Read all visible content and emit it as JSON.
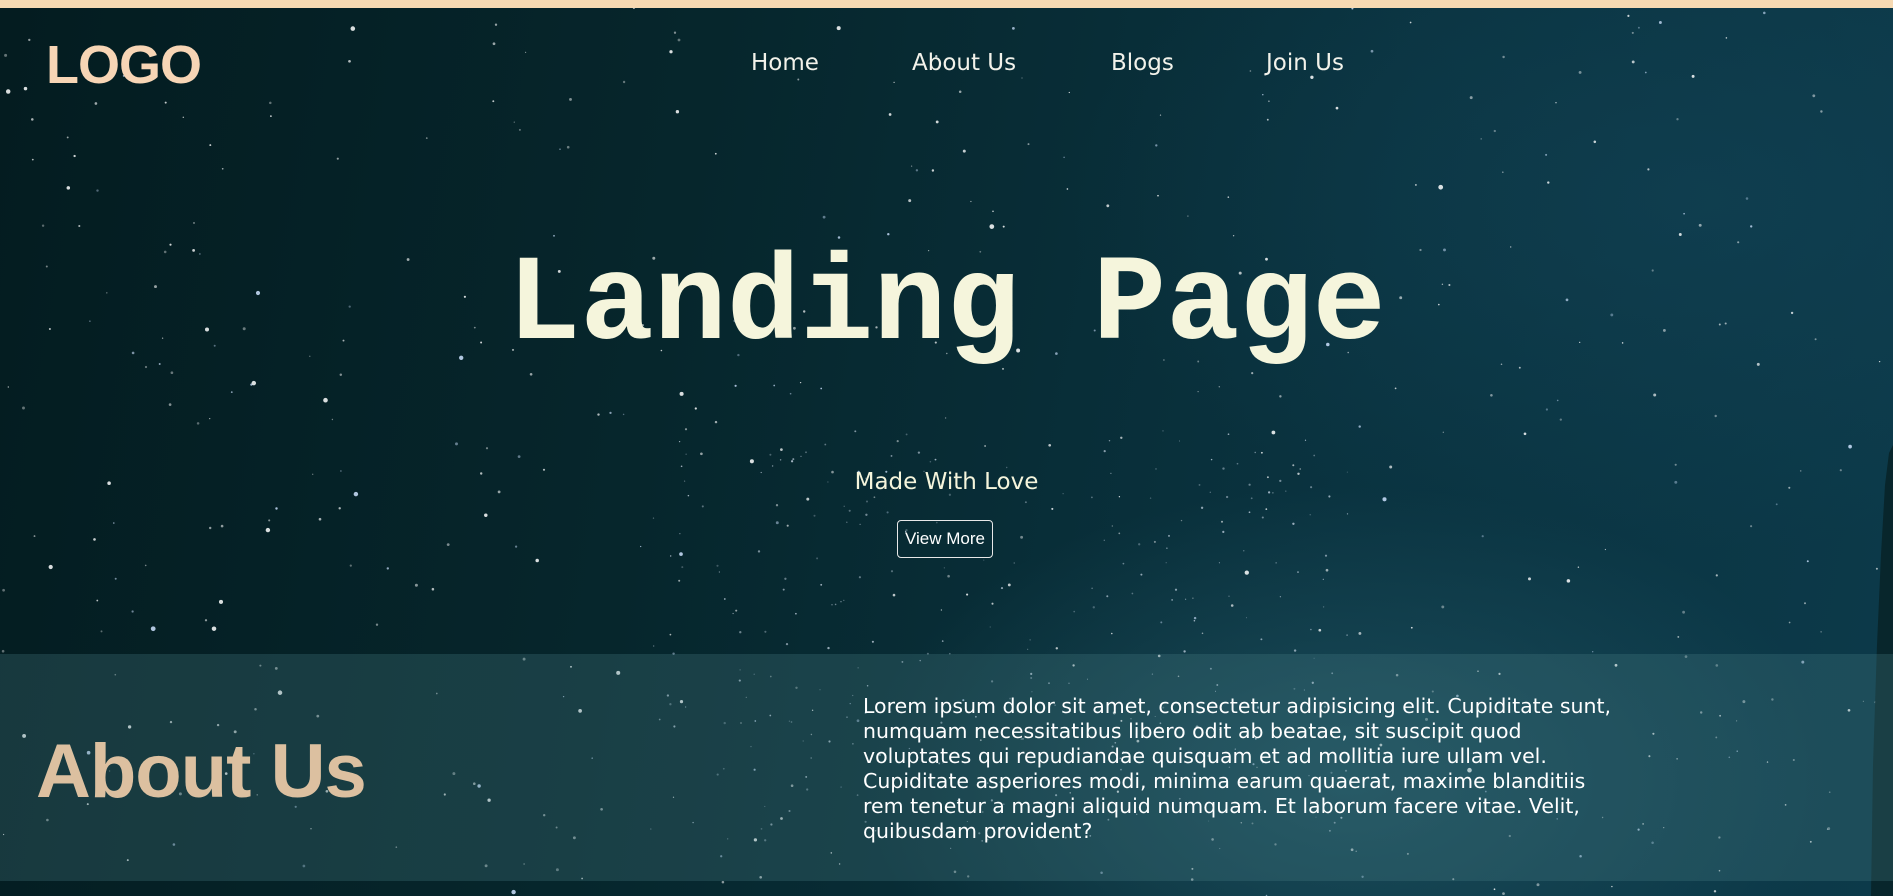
{
  "brand": {
    "logo_text": "LOGO",
    "accent_color": "#f7d5b5"
  },
  "nav": {
    "items": [
      {
        "label": "Home"
      },
      {
        "label": "About Us"
      },
      {
        "label": "Blogs"
      },
      {
        "label": "Join Us"
      }
    ]
  },
  "hero": {
    "title": "Landing Page",
    "subtitle": "Made With Love",
    "cta_label": "View More",
    "text_color": "#f5f5dc"
  },
  "about": {
    "title": "About Us",
    "body": "Lorem ipsum dolor sit amet, consectetur adipisicing elit. Cupiditate sunt, numquam necessitatibus libero odit ab beatae, sit suscipit quod voluptates qui repudiandae quisquam et ad mollitia iure ullam vel. Cupiditate asperiores modi, minima earum quaerat, maxime blanditiis rem tenetur a magni aliquid numquam. Et laborum facere vitae. Velit, quibusdam provident?",
    "title_color": "#dcc0a0"
  },
  "background": {
    "description_icon": "starry-night-sky",
    "top_strip_color": "#f6d9b2"
  }
}
